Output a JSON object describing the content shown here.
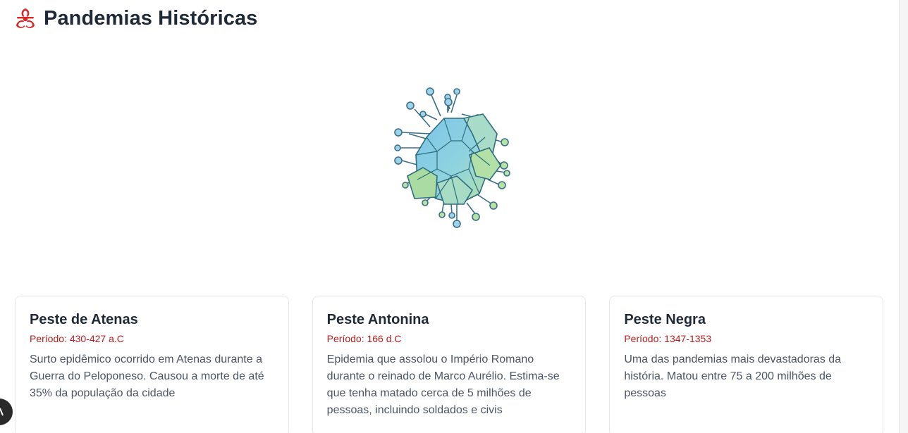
{
  "header": {
    "title": "Pandemias Históricas",
    "icon": "biohazard-icon"
  },
  "cards": [
    {
      "title": "Peste de Atenas",
      "period": "Período: 430-427 a.C",
      "description": "Surto epidêmico ocorrido em Atenas durante a Guerra do Peloponeso. Causou a morte de até 35% da população da cidade"
    },
    {
      "title": "Peste Antonina",
      "period": "Período: 166 d.C",
      "description": "Epidemia que assolou o Império Romano durante o reinado de Marco Aurélio. Estima-se que tenha matado cerca de 5 milhões de pessoas, incluindo soldados e civis"
    },
    {
      "title": "Peste Negra",
      "period": "Período: 1347-1353",
      "description": "Uma das pandemias mais devastadoras da história. Matou entre 75 a 200 milhões de pessoas"
    }
  ],
  "colors": {
    "accent": "#dc2626",
    "period": "#b91c1c",
    "virus_blue": "#8ecfe6",
    "virus_green": "#a8dca0"
  }
}
